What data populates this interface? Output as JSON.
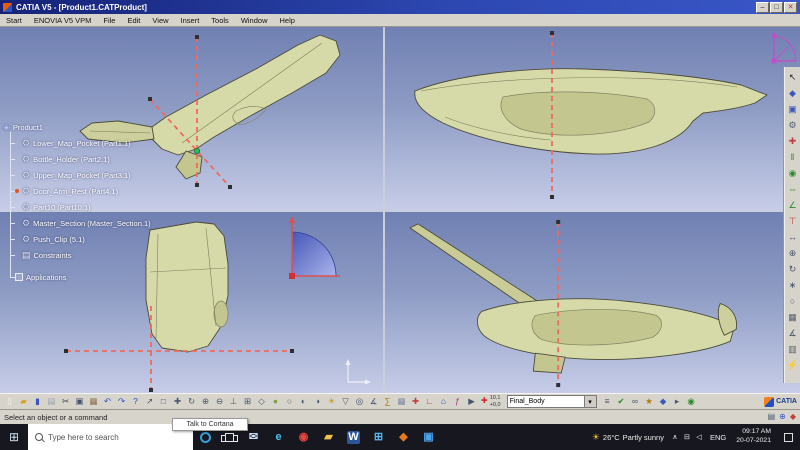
{
  "window": {
    "title": "CATIA V5 - [Product1.CATProduct]",
    "controls": [
      {
        "name": "minimize-button",
        "glyph": "–",
        "color": "#222222"
      },
      {
        "name": "maximize-button",
        "glyph": "□",
        "color": "#222222"
      },
      {
        "name": "close-button",
        "glyph": "✕",
        "color": "#c03030"
      }
    ]
  },
  "menu": {
    "items": [
      {
        "name": "menu-start",
        "label": "Start"
      },
      {
        "name": "menu-enovia",
        "label": "ENOVIA V5 VPM"
      },
      {
        "name": "menu-file",
        "label": "File"
      },
      {
        "name": "menu-edit",
        "label": "Edit"
      },
      {
        "name": "menu-view",
        "label": "View"
      },
      {
        "name": "menu-insert",
        "label": "Insert"
      },
      {
        "name": "menu-tools",
        "label": "Tools"
      },
      {
        "name": "menu-window",
        "label": "Window"
      },
      {
        "name": "menu-help",
        "label": "Help"
      }
    ]
  },
  "tree": {
    "root": {
      "label": "Product1",
      "icon_name": "product-icon",
      "icon_glyph": "◈",
      "icon_color": "#b8c6ff"
    },
    "items": [
      {
        "name": "tree-item-lower-map-pocket",
        "label": "Lower_Map_Pocket (Part1.1)",
        "icon_name": "part-icon",
        "icon_glyph": "⚙",
        "icon_color": "#cfd8ea",
        "marker": ""
      },
      {
        "name": "tree-item-bottle-holder",
        "label": "Bottle_Holder (Part2.1)",
        "icon_name": "part-icon",
        "icon_glyph": "⚙",
        "icon_color": "#cfd8ea",
        "marker": ""
      },
      {
        "name": "tree-item-upper-map-pocket",
        "label": "Upper_Map_Pocket (Part3.1)",
        "icon_name": "part-icon",
        "icon_glyph": "⚙",
        "icon_color": "#cfd8ea",
        "marker": ""
      },
      {
        "name": "tree-item-door-arm-rest",
        "label": "Door_Arm_Rest (Part4.1)",
        "icon_name": "part-icon",
        "icon_glyph": "⚙",
        "icon_color": "#cfd8ea",
        "marker": "#e8521e"
      },
      {
        "name": "tree-item-part10",
        "label": "Part10 (Part10.1)",
        "icon_name": "part-icon",
        "icon_glyph": "⚙",
        "icon_color": "#cfd8ea",
        "marker": ""
      },
      {
        "name": "tree-item-master-section",
        "label": "Master_Section (Master_Section.1)",
        "icon_name": "part-icon",
        "icon_glyph": "⚙",
        "icon_color": "#cfd8ea",
        "marker": ""
      },
      {
        "name": "tree-item-push-clip",
        "label": "Push_Clip (5.1)",
        "icon_name": "part-icon",
        "icon_glyph": "⚙",
        "icon_color": "#cfd8ea",
        "marker": ""
      },
      {
        "name": "tree-item-constraints",
        "label": "Constraints",
        "icon_name": "constraints-icon",
        "icon_glyph": "▤",
        "icon_color": "#e8ecf8",
        "marker": ""
      }
    ],
    "applications_label": "Applications"
  },
  "toolbar_right": {
    "icons": [
      {
        "name": "select-arrow-icon",
        "glyph": "↖",
        "color": "#2b2b2b"
      },
      {
        "name": "product-structure-icon",
        "glyph": "◆",
        "color": "#3a57c0"
      },
      {
        "name": "component-icon",
        "glyph": "▣",
        "color": "#3a57c0"
      },
      {
        "name": "part-design-icon",
        "glyph": "⚙",
        "color": "#55606e"
      },
      {
        "name": "fastener-icon",
        "glyph": "✚",
        "color": "#c04040"
      },
      {
        "name": "coincidence-constraint-icon",
        "glyph": "‖",
        "color": "#2a8a2a"
      },
      {
        "name": "contact-constraint-icon",
        "glyph": "◉",
        "color": "#2a8a2a"
      },
      {
        "name": "offset-constraint-icon",
        "glyph": "⇔",
        "color": "#2a8a2a"
      },
      {
        "name": "angle-constraint-icon",
        "glyph": "∠",
        "color": "#2a8a2a"
      },
      {
        "name": "fix-component-icon",
        "glyph": "⊤",
        "color": "#c04040"
      },
      {
        "name": "manipulate-icon",
        "glyph": "↔",
        "color": "#45566e"
      },
      {
        "name": "snap-icon",
        "glyph": "⊕",
        "color": "#45566e"
      },
      {
        "name": "smart-move-icon",
        "glyph": "↻",
        "color": "#45566e"
      },
      {
        "name": "explode-icon",
        "glyph": "∗",
        "color": "#45566e"
      },
      {
        "name": "hole-icon",
        "glyph": "○",
        "color": "#55606e"
      },
      {
        "name": "pattern-icon",
        "glyph": "▦",
        "color": "#55606e"
      },
      {
        "name": "measure-icon",
        "glyph": "∡",
        "color": "#45566e"
      },
      {
        "name": "sectioning-icon",
        "glyph": "▥",
        "color": "#55606e"
      },
      {
        "name": "update-icon",
        "glyph": "⚡",
        "color": "#c07a10"
      }
    ]
  },
  "toolbar_bottom": {
    "icons_left": [
      {
        "name": "new-document-icon",
        "glyph": "▯",
        "color": "#f8f8f8"
      },
      {
        "name": "open-icon",
        "glyph": "▰",
        "color": "#d9a31e"
      },
      {
        "name": "save-icon",
        "glyph": "▮",
        "color": "#3a57c0"
      },
      {
        "name": "print-icon",
        "glyph": "▤",
        "color": "#9aa0ac"
      },
      {
        "name": "cut-icon",
        "glyph": "✂",
        "color": "#3d3d3d"
      },
      {
        "name": "copy-icon",
        "glyph": "▣",
        "color": "#44506a"
      },
      {
        "name": "paste-icon",
        "glyph": "▦",
        "color": "#8a6a4a"
      },
      {
        "name": "undo-icon",
        "glyph": "↶",
        "color": "#2a50c0"
      },
      {
        "name": "redo-icon",
        "glyph": "↷",
        "color": "#2a50c0"
      },
      {
        "name": "help-icon",
        "glyph": "?",
        "color": "#2a50c0"
      },
      {
        "name": "fly-mode-icon",
        "glyph": "↗",
        "color": "#45566e"
      },
      {
        "name": "fit-all-in-icon",
        "glyph": "□",
        "color": "#45566e"
      },
      {
        "name": "pan-icon",
        "glyph": "✚",
        "color": "#45566e"
      },
      {
        "name": "rotate-icon",
        "glyph": "↻",
        "color": "#45566e"
      },
      {
        "name": "zoom-in-icon",
        "glyph": "⊕",
        "color": "#45566e"
      },
      {
        "name": "zoom-out-icon",
        "glyph": "⊖",
        "color": "#45566e"
      },
      {
        "name": "normal-view-icon",
        "glyph": "⊥",
        "color": "#45566e"
      },
      {
        "name": "multi-view-icon",
        "glyph": "⊞",
        "color": "#45566e"
      },
      {
        "name": "isometric-view-icon",
        "glyph": "◇",
        "color": "#45566e"
      },
      {
        "name": "shading-icon",
        "glyph": "●",
        "color": "#7c9f4a"
      },
      {
        "name": "wireframe-icon",
        "glyph": "○",
        "color": "#666666"
      },
      {
        "name": "hide-show-icon",
        "glyph": "◐",
        "color": "#45566e"
      },
      {
        "name": "swap-visible-space-icon",
        "glyph": "◑",
        "color": "#45566e"
      },
      {
        "name": "light-icon",
        "glyph": "☀",
        "color": "#c39a10"
      },
      {
        "name": "depth-effect-icon",
        "glyph": "▽",
        "color": "#45566e"
      },
      {
        "name": "magnifier-icon",
        "glyph": "◎",
        "color": "#45566e"
      },
      {
        "name": "measure-between-icon",
        "glyph": "∡",
        "color": "#45566e"
      },
      {
        "name": "mass-properties-icon",
        "glyph": "∑",
        "color": "#b07a10"
      },
      {
        "name": "grid-icon",
        "glyph": "▦",
        "color": "#7a86a0"
      },
      {
        "name": "snap-to-point-icon",
        "glyph": "✚",
        "color": "#c04040"
      },
      {
        "name": "axis-system-icon",
        "glyph": "∟",
        "color": "#c04040"
      },
      {
        "name": "catalog-icon",
        "glyph": "⌂",
        "color": "#2a50c0"
      },
      {
        "name": "knowledge-formula-icon",
        "glyph": "ƒ",
        "color": "#a03090"
      },
      {
        "name": "macro-play-icon",
        "glyph": "▶",
        "color": "#45566e"
      }
    ],
    "coord": {
      "cross_glyph": "✚",
      "line1": "10,1",
      "line2": "+0,0"
    },
    "combo": {
      "value": "Final_Body",
      "arrow": "▾"
    },
    "icons_right": [
      {
        "name": "graph-tree-icon",
        "glyph": "≡",
        "color": "#45566e"
      },
      {
        "name": "constraints-check-icon",
        "glyph": "✔",
        "color": "#2a8a2a"
      },
      {
        "name": "link-manager-icon",
        "glyph": "∞",
        "color": "#45566e"
      },
      {
        "name": "power-copy-icon",
        "glyph": "★",
        "color": "#b07a10"
      },
      {
        "name": "datum-icon",
        "glyph": "◆",
        "color": "#3a57c0"
      },
      {
        "name": "scan-icon",
        "glyph": "▸",
        "color": "#45566e"
      },
      {
        "name": "world-icon",
        "glyph": "◉",
        "color": "#2a8a2a"
      }
    ],
    "brand": "CATIA"
  },
  "statusbar": {
    "message": "Select an object or a command",
    "tooltip": "Talk to Cortana",
    "icons": [
      {
        "name": "status-doc-icon",
        "glyph": "▤",
        "color": "#45566e"
      },
      {
        "name": "status-link-icon",
        "glyph": "⊕",
        "color": "#3a57c0"
      },
      {
        "name": "status-flag-icon",
        "glyph": "◆",
        "color": "#c04040"
      }
    ]
  },
  "taskbar": {
    "start_glyph": "⊞",
    "search_placeholder": "Type here to search",
    "apps": [
      {
        "name": "taskbar-mail-icon",
        "glyph": "✉",
        "color": "#cfe3f7",
        "bg": ""
      },
      {
        "name": "taskbar-edge-icon",
        "glyph": "e",
        "color": "#49c3e8",
        "bg": ""
      },
      {
        "name": "taskbar-chrome-icon",
        "glyph": "◉",
        "color": "#e8453c",
        "bg": ""
      },
      {
        "name": "taskbar-explorer-icon",
        "glyph": "▰",
        "color": "#f0c24c",
        "bg": ""
      },
      {
        "name": "taskbar-word-icon",
        "glyph": "W",
        "color": "#ffffff",
        "bg": "#2b579a"
      },
      {
        "name": "taskbar-store-icon",
        "glyph": "⊞",
        "color": "#58b6e8",
        "bg": ""
      },
      {
        "name": "taskbar-catia-icon",
        "glyph": "◆",
        "color": "#e87a1e",
        "bg": ""
      },
      {
        "name": "taskbar-photos-icon",
        "glyph": "▣",
        "color": "#4aa3e8",
        "bg": ""
      }
    ],
    "tray": {
      "weather_icon": "☀",
      "temp": "26°C",
      "desc": "Partly sunny",
      "icons": [
        {
          "name": "tray-expand-icon",
          "glyph": "∧"
        },
        {
          "name": "tray-network-icon",
          "glyph": "⊟"
        },
        {
          "name": "tray-volume-icon",
          "glyph": "◁"
        }
      ],
      "lang": "ENG",
      "time": "09:17 AM",
      "date": "20-07-2021"
    }
  }
}
